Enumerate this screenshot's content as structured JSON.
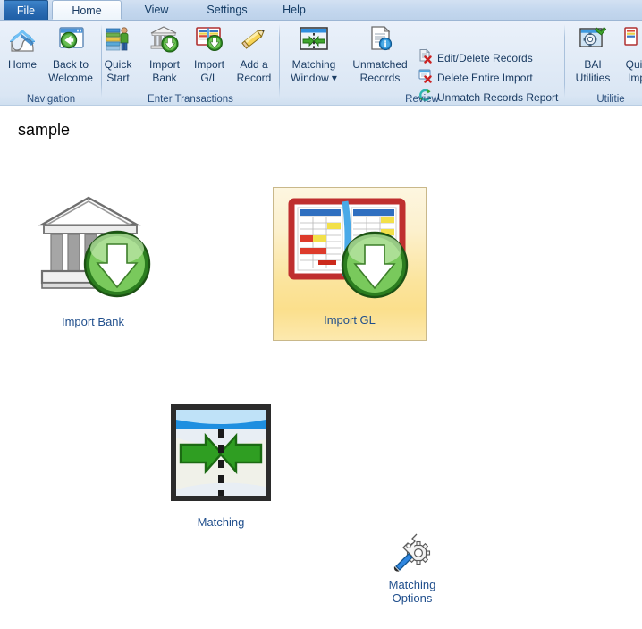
{
  "window": {
    "tabs": [
      {
        "id": "file",
        "label": "File",
        "state": "button"
      },
      {
        "id": "home",
        "label": "Home",
        "state": "selected"
      },
      {
        "id": "view",
        "label": "View",
        "state": "normal"
      },
      {
        "id": "settings",
        "label": "Settings",
        "state": "normal"
      },
      {
        "id": "help",
        "label": "Help",
        "state": "normal"
      }
    ]
  },
  "ribbon": {
    "groups": [
      {
        "id": "navigation",
        "label": "Navigation"
      },
      {
        "id": "enter-transactions",
        "label": "Enter Transactions"
      },
      {
        "id": "review",
        "label": "Review"
      },
      {
        "id": "utilities",
        "label": "Utilitie"
      }
    ],
    "buttons": {
      "home": {
        "line1": "Home",
        "line2": "",
        "icon": "house-icon"
      },
      "back_to_welcome": {
        "line1": "Back to",
        "line2": "Welcome",
        "icon": "window-back-arrow-icon"
      },
      "quick_start": {
        "line1": "Quick",
        "line2": "Start",
        "icon": "books-person-icon"
      },
      "import_bank": {
        "line1": "Import",
        "line2": "Bank",
        "icon": "bank-download-icon"
      },
      "import_gl": {
        "line1": "Import",
        "line2": "G/L",
        "icon": "ledger-download-icon"
      },
      "add_a_record": {
        "line1": "Add a",
        "line2": "Record",
        "icon": "pencil-icon"
      },
      "matching_window": {
        "line1": "Matching",
        "line2": "Window",
        "icon": "matching-arrows-icon",
        "dropdown": "▾"
      },
      "unmatched_records": {
        "line1": "Unmatched",
        "line2": "Records",
        "icon": "document-info-icon"
      },
      "bai_utilities": {
        "line1": "BAI",
        "line2": "Utilities",
        "icon": "gear-window-icon"
      },
      "quick_import": {
        "line1": "Quic",
        "line2": "Imp",
        "icon": "quick-import-icon"
      }
    },
    "small_buttons": [
      {
        "id": "edit-delete-records",
        "label": "Edit/Delete Records",
        "icon": "document-delete-icon"
      },
      {
        "id": "delete-entire-import",
        "label": "Delete Entire Import",
        "icon": "window-delete-icon"
      },
      {
        "id": "unmatch-records-report",
        "label": "Unmatch Records Report",
        "icon": "refresh-icon"
      }
    ]
  },
  "workspace": {
    "title": "sample",
    "tiles": [
      {
        "id": "import-bank",
        "label": "Import Bank",
        "icon": "bank-download-icon",
        "hover": false
      },
      {
        "id": "import-gl",
        "label": "Import GL",
        "icon": "ledger-download-icon",
        "hover": true
      },
      {
        "id": "matching",
        "label": "Matching",
        "icon": "matching-arrows-icon",
        "hover": false
      },
      {
        "id": "matching-options",
        "label_line1": "Matching",
        "label_line2": "Options",
        "icon": "wrench-gear-icon",
        "hover": false
      }
    ]
  },
  "colors": {
    "tab_file_blue": "#2a6cb3",
    "ribbon_bg": "#e3ecf7",
    "link_blue": "#1f4e8c",
    "hover_gold": "#fbe49c",
    "group_label": "#2b4f7d"
  }
}
